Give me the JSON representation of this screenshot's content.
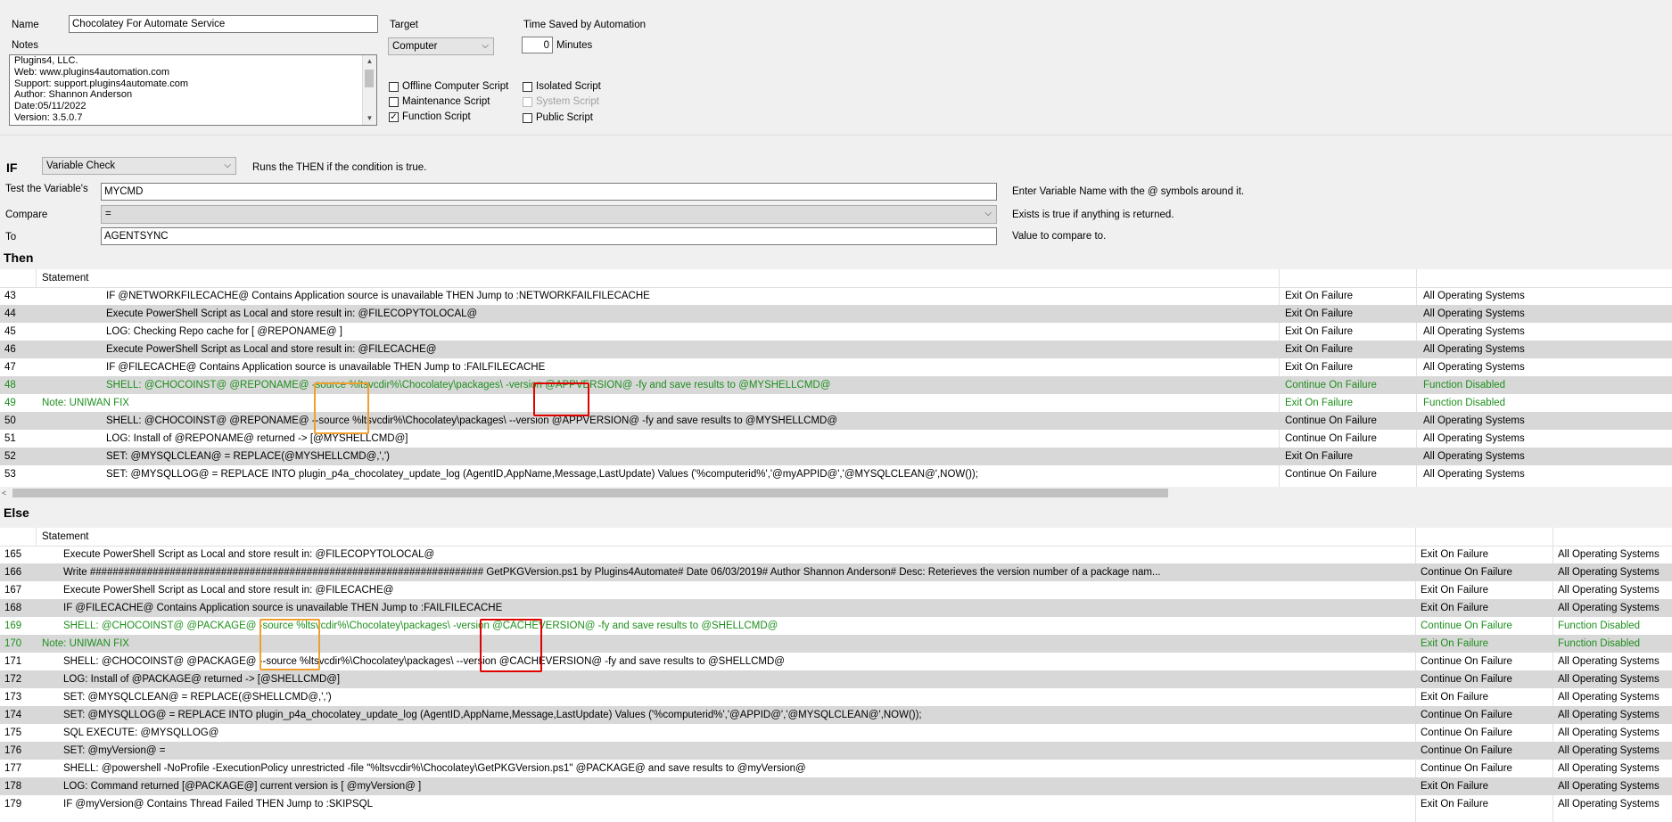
{
  "form": {
    "name_label": "Name",
    "name_value": "Chocolatey For Automate Service",
    "notes_label": "Notes",
    "notes_lines": [
      "Plugins4, LLC.",
      "Web: www.plugins4automation.com",
      "Support: support.plugins4automate.com",
      "Author: Shannon Anderson",
      "Date:05/11/2022",
      "Version: 3.5.0.7"
    ],
    "target_label": "Target",
    "target_value": "Computer",
    "time_saved_label": "Time Saved by Automation",
    "time_saved_value": "0",
    "minutes_label": "Minutes",
    "checkboxes": [
      {
        "label": "Offline Computer Script",
        "checked": false
      },
      {
        "label": "Maintenance Script",
        "checked": false
      },
      {
        "label": "Function Script",
        "checked": true
      },
      {
        "label": "Isolated Script",
        "checked": false
      },
      {
        "label": "System Script",
        "checked": false,
        "disabled": true
      },
      {
        "label": "Public Script",
        "checked": false
      }
    ]
  },
  "condition": {
    "if_label": "IF",
    "type_value": "Variable Check",
    "type_hint": "Runs the THEN if the condition is true.",
    "test_label": "Test the Variable's",
    "test_value": "MYCMD",
    "test_hint": "Enter Variable Name with the @ symbols around it.",
    "compare_label": "Compare",
    "compare_value": "=",
    "compare_hint": "Exists is true if anything is returned.",
    "to_label": "To",
    "to_value": "AGENTSYNC",
    "to_hint": "Value to compare to."
  },
  "then_section": {
    "title": "Then",
    "column_header": "Statement",
    "rows": [
      {
        "num": "43",
        "stmt": "IF  @NETWORKFILECACHE@  Contains  Application source is unavailable  THEN  Jump to :NETWORKFAILFILECACHE",
        "fail": "Exit On Failure",
        "os": "All Operating Systems"
      },
      {
        "num": "44",
        "stmt": "Execute PowerShell Script as Local and store result in: @FILECOPYTOLOCAL@",
        "fail": "Exit On Failure",
        "os": "All Operating Systems"
      },
      {
        "num": "45",
        "stmt": "LOG:  Checking Repo cache for  [ @REPONAME@ ]",
        "fail": "Exit On Failure",
        "os": "All Operating Systems"
      },
      {
        "num": "46",
        "stmt": "Execute PowerShell Script as Local and store result in: @FILECACHE@",
        "fail": "Exit On Failure",
        "os": "All Operating Systems"
      },
      {
        "num": "47",
        "stmt": "IF  @FILECACHE@  Contains  Application source is unavailable  THEN  Jump to :FAILFILECACHE",
        "fail": "Exit On Failure",
        "os": "All Operating Systems"
      },
      {
        "num": "48",
        "stmt": "SHELL:  @CHOCOINST@ @REPONAME@ -source %ltsvcdir%\\Chocolatey\\packages\\ -version @APPVERSION@ -fy and save results to @MYSHELLCMD@",
        "fail": "Continue On Failure",
        "os": "Function Disabled"
      },
      {
        "num": "49",
        "stmt": "Note: UNIWAN FIX",
        "fail": "Exit On Failure",
        "os": "Function Disabled"
      },
      {
        "num": "50",
        "stmt": "SHELL:  @CHOCOINST@ @REPONAME@ --source %ltsvcdir%\\Chocolatey\\packages\\ --version @APPVERSION@ -fy and save results to @MYSHELLCMD@",
        "fail": "Continue On Failure",
        "os": "All Operating Systems"
      },
      {
        "num": "51",
        "stmt": "LOG:  Install of @REPONAME@ returned -> [@MYSHELLCMD@]",
        "fail": "Continue On Failure",
        "os": "All Operating Systems"
      },
      {
        "num": "52",
        "stmt": "SET: @MYSQLCLEAN@ = REPLACE(@MYSHELLCMD@,',')",
        "fail": "Exit On Failure",
        "os": "All Operating Systems"
      },
      {
        "num": "53",
        "stmt": "SET:  @MYSQLLOG@ = REPLACE INTO plugin_p4a_chocolatey_update_log (AgentID,AppName,Message,LastUpdate) Values ('%computerid%','@myAPPID@','@MYSQLCLEAN@',NOW());",
        "fail": "Continue On Failure",
        "os": "All Operating Systems"
      }
    ]
  },
  "else_section": {
    "title": "Else",
    "column_header": "Statement",
    "rows": [
      {
        "num": "165",
        "stmt": "Execute PowerShell Script as Local and store result in: @FILECOPYTOLOCAL@",
        "fail": "Exit On Failure",
        "os": "All Operating Systems"
      },
      {
        "num": "166",
        "stmt": "Write  ##################################################################### GetPKGVersion.ps1  by Plugins4Automate# Date 06/03/2019# Author Shannon Anderson# Desc: Reterieves the version number of a package nam...",
        "fail": "Continue On Failure",
        "os": "All Operating Systems"
      },
      {
        "num": "167",
        "stmt": "Execute PowerShell Script as Local and store result in: @FILECACHE@",
        "fail": "Exit On Failure",
        "os": "All Operating Systems"
      },
      {
        "num": "168",
        "stmt": "IF  @FILECACHE@  Contains  Application source is unavailable  THEN  Jump to :FAILFILECACHE",
        "fail": "Exit On Failure",
        "os": "All Operating Systems"
      },
      {
        "num": "169",
        "stmt": "SHELL:  @CHOCOINST@ @PACKAGE@ -source %ltsvcdir%\\Chocolatey\\packages\\ -version @CACHEVERSION@ -fy and save results to @SHELLCMD@",
        "fail": "Continue On Failure",
        "os": "Function Disabled"
      },
      {
        "num": "170",
        "stmt": "Note: UNIWAN FIX",
        "fail": "Exit On Failure",
        "os": "Function Disabled"
      },
      {
        "num": "171",
        "stmt": "SHELL:  @CHOCOINST@ @PACKAGE@ --source %ltsvcdir%\\Chocolatey\\packages\\ --version @CACHEVERSION@ -fy and save results to @SHELLCMD@",
        "fail": "Continue On Failure",
        "os": "All Operating Systems"
      },
      {
        "num": "172",
        "stmt": "LOG:  Install of @PACKAGE@ returned -> [@SHELLCMD@]",
        "fail": "Continue On Failure",
        "os": "All Operating Systems"
      },
      {
        "num": "173",
        "stmt": "SET: @MYSQLCLEAN@ = REPLACE(@SHELLCMD@,',')",
        "fail": "Exit On Failure",
        "os": "All Operating Systems"
      },
      {
        "num": "174",
        "stmt": "SET:  @MYSQLLOG@ = REPLACE INTO plugin_p4a_chocolatey_update_log (AgentID,AppName,Message,LastUpdate) Values ('%computerid%','@APPID@','@MYSQLCLEAN@',NOW());",
        "fail": "Continue On Failure",
        "os": "All Operating Systems"
      },
      {
        "num": "175",
        "stmt": "SQL EXECUTE: @MYSQLLOG@",
        "fail": "Continue On Failure",
        "os": "All Operating Systems"
      },
      {
        "num": "176",
        "stmt": "SET:  @myVersion@ =",
        "fail": "Continue On Failure",
        "os": "All Operating Systems"
      },
      {
        "num": "177",
        "stmt": "SHELL:  @powershell -NoProfile -ExecutionPolicy unrestricted -file \"%ltsvcdir%\\Chocolatey\\GetPKGVersion.ps1\" @PACKAGE@ and save results to @myVersion@",
        "fail": "Continue On Failure",
        "os": "All Operating Systems"
      },
      {
        "num": "178",
        "stmt": "LOG:  Command returned [@PACKAGE@] current version is [ @myVersion@ ]",
        "fail": "Exit On Failure",
        "os": "All Operating Systems"
      },
      {
        "num": "179",
        "stmt": "IF  @myVersion@  Contains  Thread Failed  THEN  Jump to :SKIPSQL",
        "fail": "Exit On Failure",
        "os": "All Operating Systems"
      }
    ]
  },
  "colors": {
    "disabled_row_text": "#1d8f1d",
    "alt_row_bg": "#d8d8d8",
    "highlight_orange": "#f0a030",
    "highlight_red": "#e00000"
  }
}
